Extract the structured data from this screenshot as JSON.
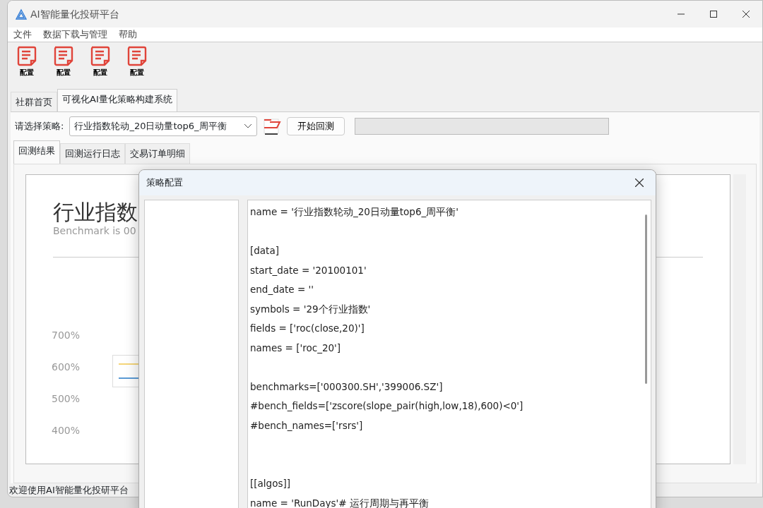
{
  "window": {
    "title": "AI智能量化投研平台"
  },
  "menu": [
    "文件",
    "数据下载与管理",
    "帮助"
  ],
  "toolbar": [
    {
      "label": "配置"
    },
    {
      "label": "配置"
    },
    {
      "label": "配置"
    },
    {
      "label": "配置"
    }
  ],
  "tabs": [
    {
      "label": "社群首页",
      "selected": false
    },
    {
      "label": "可视化AI量化策略构建系统",
      "selected": true
    }
  ],
  "strategy": {
    "label": "请选择策略:",
    "value": "行业指数轮动_20日动量top6_周平衡",
    "run_button": "开始回测",
    "progress": {
      "level": 0
    }
  },
  "result_tabs": [
    {
      "label": "回测结果",
      "selected": true
    },
    {
      "label": "回测运行日志",
      "selected": false
    },
    {
      "label": "交易订单明细",
      "selected": false
    }
  ],
  "report": {
    "title": "行业指数",
    "subtitle": "Benchmark is 00",
    "y_ticks": [
      "700%",
      "600%",
      "500%",
      "400%"
    ],
    "legend": [
      {
        "color": "#f5d67a"
      },
      {
        "color": "#5b9bd5"
      }
    ]
  },
  "status_bar": "欢迎使用AI智能量化投研平台",
  "dialog": {
    "title": "策略配置",
    "code_blocks": [
      {
        "lines": [
          "name = '行业指数轮动_20日动量top6_周平衡'"
        ]
      },
      {
        "lines": [
          "[data]",
          "start_date = '20100101'",
          "end_date = ''",
          "symbols = '29个行业指数'",
          "fields = ['roc(close,20)']",
          "names = ['roc_20']"
        ]
      },
      {
        "lines": [
          "benchmarks=['000300.SH','399006.SZ']",
          "#bench_fields=['zscore(slope_pair(high,low,18),600)<0']",
          "#bench_names=['rsrs']"
        ]
      },
      {
        "lines": [
          "[[algos]]",
          "name = 'RunDays'# 运行周期与再平衡"
        ]
      }
    ]
  }
}
